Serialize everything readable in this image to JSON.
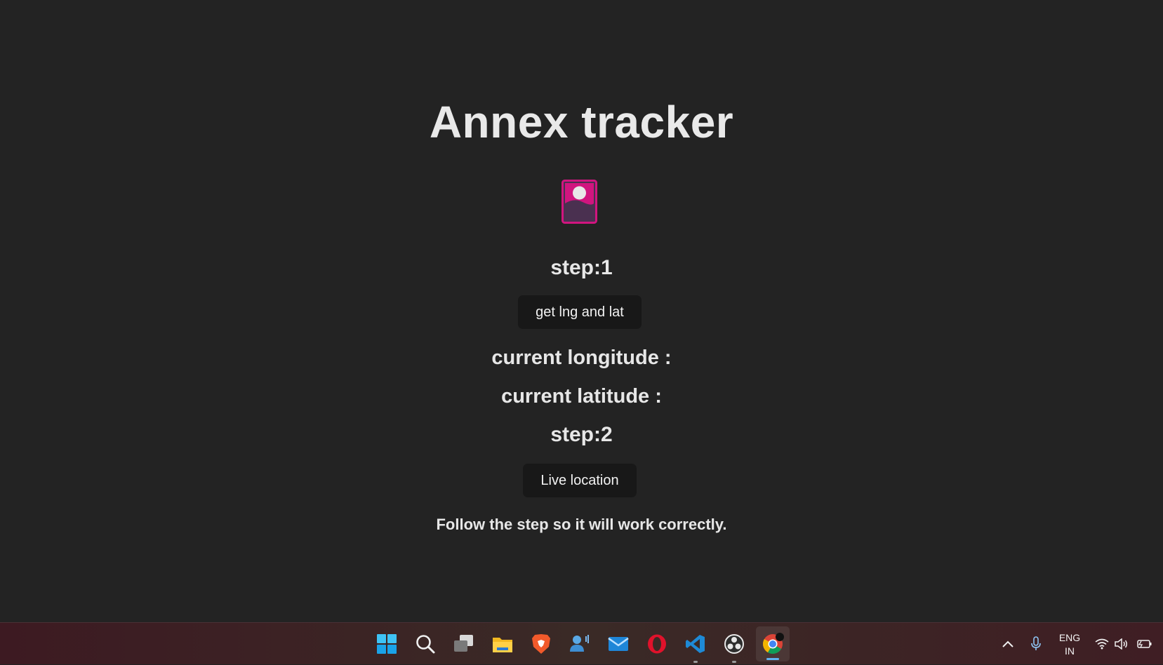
{
  "app": {
    "title": "Annex tracker"
  },
  "logo": {
    "icon": "image-placeholder-icon",
    "colors": {
      "frame": "#d1157f",
      "fill": "#4a3050",
      "circle": "#e8e8e8"
    }
  },
  "step1": {
    "label": "step:1",
    "button_label": "get lng and lat"
  },
  "coords": {
    "longitude_label": "current longitude :",
    "latitude_label": "current latitude :"
  },
  "step2": {
    "label": "step:2",
    "button_label": "Live location"
  },
  "note": "Follow the step so it will work correctly.",
  "taskbar": {
    "apps": [
      {
        "name": "start-icon"
      },
      {
        "name": "search-icon"
      },
      {
        "name": "task-view-icon"
      },
      {
        "name": "file-explorer-icon"
      },
      {
        "name": "brave-browser-icon"
      },
      {
        "name": "teams-icon"
      },
      {
        "name": "mail-icon"
      },
      {
        "name": "opera-browser-icon"
      },
      {
        "name": "vscode-icon",
        "running": true
      },
      {
        "name": "obs-studio-icon",
        "running": true
      },
      {
        "name": "chrome-icon",
        "active": true
      }
    ],
    "tray": {
      "language_line1": "ENG",
      "language_line2": "IN"
    }
  }
}
